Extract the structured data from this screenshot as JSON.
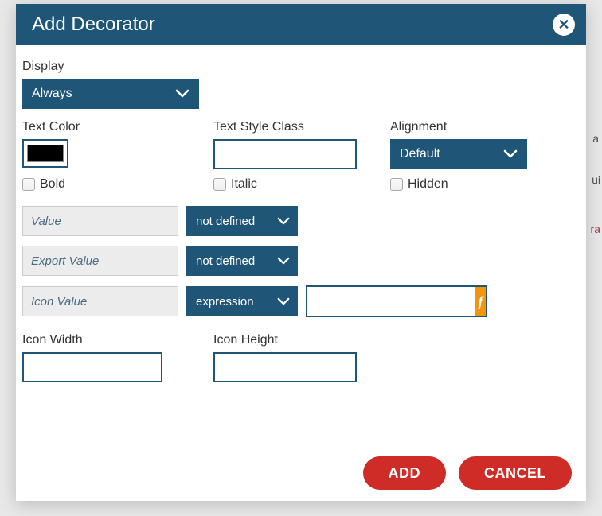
{
  "header": {
    "title": "Add Decorator"
  },
  "fields": {
    "display": {
      "label": "Display",
      "value": "Always"
    },
    "textColor": {
      "label": "Text Color",
      "value": "#000000"
    },
    "textStyleClass": {
      "label": "Text Style Class",
      "value": ""
    },
    "alignment": {
      "label": "Alignment",
      "value": "Default"
    },
    "bold": {
      "label": "Bold",
      "checked": false
    },
    "italic": {
      "label": "Italic",
      "checked": false
    },
    "hidden": {
      "label": "Hidden",
      "checked": false
    },
    "value": {
      "label": "Value",
      "mode": "not defined"
    },
    "exportValue": {
      "label": "Export Value",
      "mode": "not defined"
    },
    "iconValue": {
      "label": "Icon Value",
      "mode": "expression",
      "expr": ""
    },
    "iconWidth": {
      "label": "Icon Width",
      "value": ""
    },
    "iconHeight": {
      "label": "Icon Height",
      "value": ""
    }
  },
  "footer": {
    "add": "ADD",
    "cancel": "CANCEL"
  },
  "background": {
    "frag1": "a",
    "frag2": "ui",
    "frag3": "ra"
  }
}
